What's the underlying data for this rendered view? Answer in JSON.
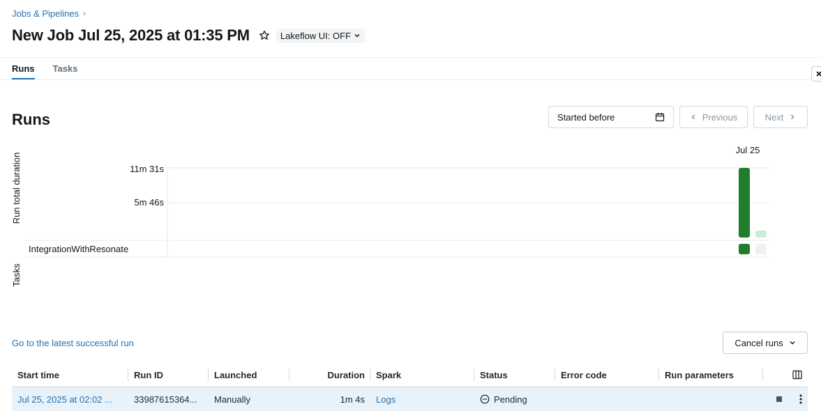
{
  "breadcrumb": {
    "label": "Jobs & Pipelines"
  },
  "header": {
    "title": "New Job Jul 25, 2025 at 01:35 PM",
    "lakeflow_label": "Lakeflow UI: OFF"
  },
  "tabs": [
    {
      "label": "Runs",
      "active": true
    },
    {
      "label": "Tasks",
      "active": false
    }
  ],
  "runs_section": {
    "heading": "Runs",
    "date_filter_placeholder": "Started before",
    "previous_label": "Previous",
    "next_label": "Next"
  },
  "chart_data": {
    "type": "bar",
    "ylabel": "Run total duration",
    "tasks_label": "Tasks",
    "y_ticks": [
      "11m 31s",
      "5m 46s"
    ],
    "ylim_seconds": [
      0,
      691
    ],
    "column_label": "Jul 25",
    "runs": [
      {
        "duration_seconds": 691,
        "status": "Succeeded",
        "color": "#1e7e2a"
      },
      {
        "duration_seconds": 64,
        "status": "Pending",
        "color": "#c9eed6"
      }
    ],
    "task_rows": [
      {
        "name": "IntegrationWithResonate",
        "cells": [
          {
            "color": "#1e7e2a"
          },
          {
            "color": "#eef1f4"
          }
        ]
      }
    ]
  },
  "actions": {
    "latest_run_link": "Go to the latest successful run",
    "cancel_runs_label": "Cancel runs"
  },
  "table": {
    "columns": [
      "Start time",
      "Run ID",
      "Launched",
      "Duration",
      "Spark",
      "Status",
      "Error code",
      "Run parameters"
    ],
    "rows": [
      {
        "start_time": "Jul 25, 2025 at 02:02 ...",
        "run_id": "33987615364...",
        "launched": "Manually",
        "duration": "1m 4s",
        "spark": "Logs",
        "status": "Pending",
        "error_code": "",
        "run_parameters": ""
      }
    ]
  },
  "colors": {
    "accent": "#2272b4",
    "success": "#1e7e2a",
    "pending": "#c9eed6"
  }
}
